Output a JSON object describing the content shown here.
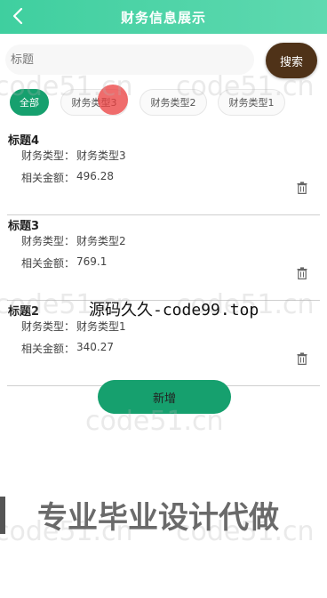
{
  "header": {
    "title": "财务信息展示",
    "back_icon": "chevron-left-icon"
  },
  "search": {
    "placeholder": "标题",
    "value": "",
    "button_label": "搜索"
  },
  "tabs": [
    {
      "label": "全部",
      "active": true
    },
    {
      "label": "财务类型3",
      "active": false
    },
    {
      "label": "财务类型2",
      "active": false
    },
    {
      "label": "财务类型1",
      "active": false
    }
  ],
  "list": {
    "type_label": "财务类型：",
    "amount_label": "相关金额：",
    "items": [
      {
        "title": "标题4",
        "type": "财务类型3",
        "amount": "496.28"
      },
      {
        "title": "标题3",
        "type": "财务类型2",
        "amount": "769.1"
      },
      {
        "title": "标题2",
        "type": "财务类型1",
        "amount": "340.27"
      }
    ]
  },
  "add_button": {
    "label": "新增"
  },
  "overlay": {
    "watermark": "code51.cn",
    "caption": "源码久久-code99.top",
    "banner": "专业毕业设计代做"
  },
  "colors": {
    "header_bg": "#3fcf9f",
    "accent_green": "#16a06e",
    "search_button": "#4f3218"
  }
}
